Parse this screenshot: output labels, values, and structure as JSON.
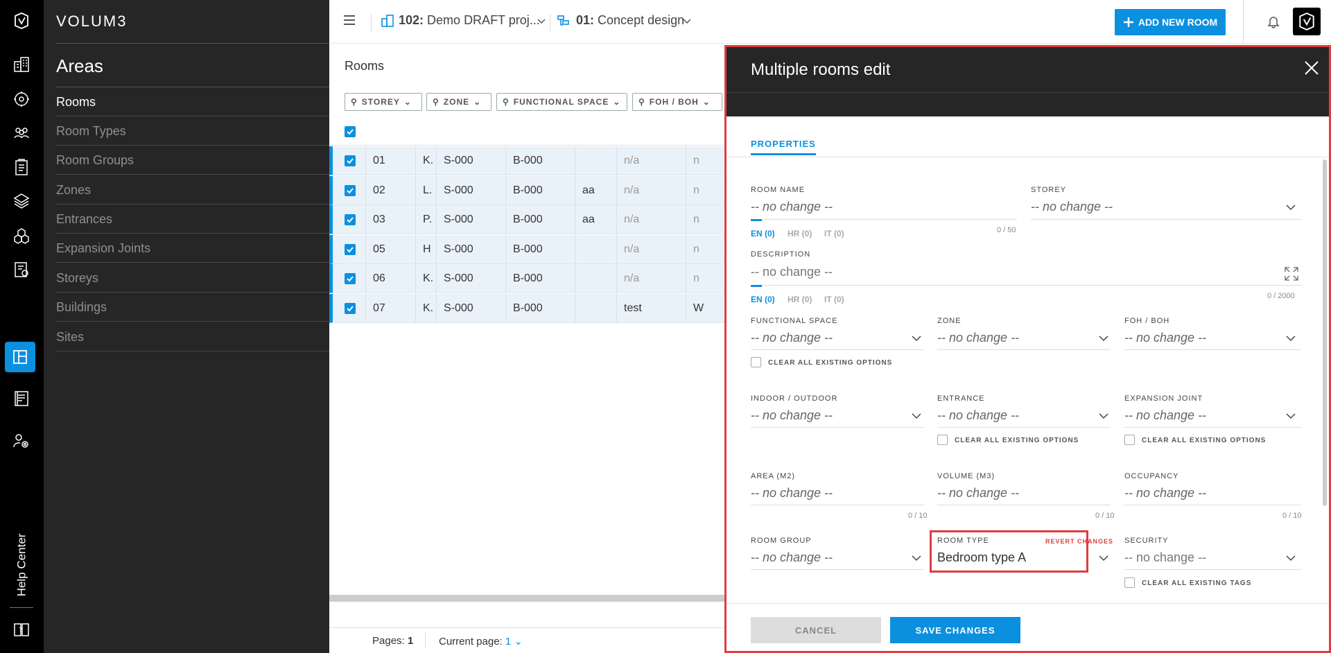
{
  "app": {
    "logo_text": "VOLUM3"
  },
  "rail": {
    "items": [
      "buildings-icon",
      "settings-cube-icon",
      "people-icon",
      "clipboard-icon",
      "layers-icon",
      "cubes-icon",
      "report-icon",
      "floorplan-icon",
      "document-icon",
      "gear-user-icon"
    ],
    "active": "floorplan-icon",
    "help_label": "Help Center"
  },
  "sidebar": {
    "title": "Areas",
    "items": [
      {
        "label": "Rooms",
        "active": true
      },
      {
        "label": "Room Types"
      },
      {
        "label": "Room Groups"
      },
      {
        "label": "Zones"
      },
      {
        "label": "Entrances"
      },
      {
        "label": "Expansion Joints"
      },
      {
        "label": "Storeys"
      },
      {
        "label": "Buildings"
      },
      {
        "label": "Sites"
      }
    ]
  },
  "topbar": {
    "project_code": "102:",
    "project_name": "Demo DRAFT proj...",
    "phase_code": "01:",
    "phase_name": "Concept design",
    "add_button": "ADD NEW ROOM"
  },
  "rooms": {
    "title": "Rooms",
    "filters": [
      "STOREY",
      "ZONE",
      "FUNCTIONAL SPACE",
      "FOH / BOH"
    ],
    "rows": [
      {
        "num": "01",
        "name": "K.",
        "storey": "S-000",
        "building": "B-000",
        "tag": "",
        "v1": "n/a",
        "v2": "n"
      },
      {
        "num": "02",
        "name": "L.",
        "storey": "S-000",
        "building": "B-000",
        "tag": "aa",
        "v1": "n/a",
        "v2": "n"
      },
      {
        "num": "03",
        "name": "P.",
        "storey": "S-000",
        "building": "B-000",
        "tag": "aa",
        "v1": "n/a",
        "v2": "n"
      },
      {
        "num": "05",
        "name": "H",
        "storey": "S-000",
        "building": "B-000",
        "tag": "",
        "v1": "n/a",
        "v2": "n"
      },
      {
        "num": "06",
        "name": "K.",
        "storey": "S-000",
        "building": "B-000",
        "tag": "",
        "v1": "n/a",
        "v2": "n"
      },
      {
        "num": "07",
        "name": "K.",
        "storey": "S-000",
        "building": "B-000",
        "tag": "",
        "v1": "test",
        "v2": "W"
      }
    ],
    "pages_label": "Pages:",
    "pages_value": "1",
    "current_page_label": "Current page:",
    "current_page_value": "1"
  },
  "modal": {
    "title": "Multiple rooms edit",
    "tab": "PROPERTIES",
    "no_change": "-- no change --",
    "room_name": {
      "label": "ROOM NAME",
      "count": "0 / 50"
    },
    "storey": {
      "label": "STOREY"
    },
    "description": {
      "label": "DESCRIPTION",
      "count": "0 / 2000"
    },
    "langs": [
      "EN (0)",
      "HR (0)",
      "IT (0)"
    ],
    "functional_space": {
      "label": "FUNCTIONAL SPACE"
    },
    "zone": {
      "label": "ZONE"
    },
    "foh_boh": {
      "label": "FOH / BOH"
    },
    "indoor_outdoor": {
      "label": "INDOOR / OUTDOOR"
    },
    "entrance": {
      "label": "ENTRANCE"
    },
    "expansion_joint": {
      "label": "EXPANSION JOINT"
    },
    "area": {
      "label": "AREA (M2)",
      "count": "0 / 10"
    },
    "volume": {
      "label": "VOLUME (M3)",
      "count": "0 / 10"
    },
    "occupancy": {
      "label": "OCCUPANCY",
      "count": "0 / 10"
    },
    "room_group": {
      "label": "ROOM GROUP"
    },
    "room_type": {
      "label": "ROOM TYPE",
      "value": "Bedroom type A",
      "revert": "REVERT CHANGES"
    },
    "security": {
      "label": "SECURITY"
    },
    "clear_options": "CLEAR ALL EXISTING OPTIONS",
    "clear_tags": "CLEAR ALL EXISTING TAGS",
    "cancel": "CANCEL",
    "save": "SAVE CHANGES"
  }
}
